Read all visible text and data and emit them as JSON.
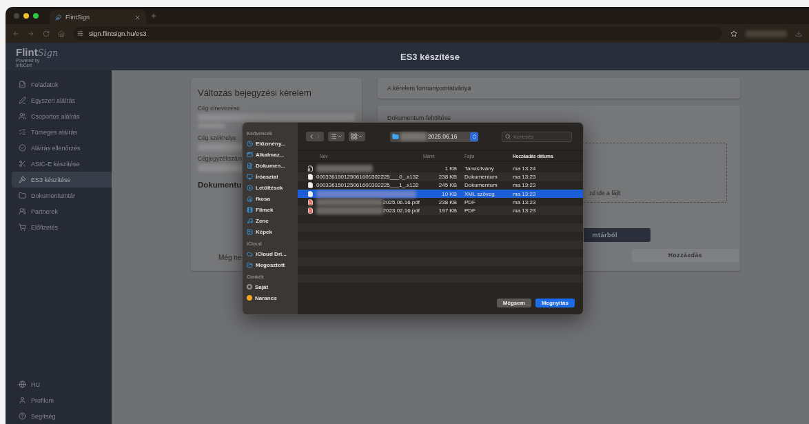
{
  "browser": {
    "tab": {
      "title": "FlintSign"
    },
    "address": "sign.flintsign.hu/es3"
  },
  "app": {
    "logo": {
      "word": "Flint",
      "script": "Sign",
      "tagline": "Powered by",
      "brand": "InfoCert"
    },
    "page_title": "ES3 készítése"
  },
  "sidebar": {
    "items": [
      {
        "label": "Feladatok",
        "selected": false
      },
      {
        "label": "Egyszeri aláírás",
        "selected": false
      },
      {
        "label": "Csoportos aláírás",
        "selected": false
      },
      {
        "label": "Tömeges aláírás",
        "selected": false
      },
      {
        "label": "Aláírás ellenőrzés",
        "selected": false
      },
      {
        "label": "ASIC-E készítése",
        "selected": false
      },
      {
        "label": "ES3 készítése",
        "selected": true
      },
      {
        "label": "Dokumentumtár",
        "selected": false
      },
      {
        "label": "Partnerek",
        "selected": false
      },
      {
        "label": "Előfizetés",
        "selected": false
      }
    ],
    "bottom": [
      {
        "label": "HU"
      },
      {
        "label": "Profilom"
      },
      {
        "label": "Segítség"
      }
    ]
  },
  "request": {
    "title": "Változás bejegyzési kérelem",
    "fields": [
      {
        "label": "Cég elnevezése"
      },
      {
        "label": "Cég székhelye"
      },
      {
        "label": "Cégjegyzékszám"
      }
    ],
    "documents_heading": "Dokumentu",
    "empty_text": "Még ne"
  },
  "form_card": {
    "title": "A kérelem formanyomtatványa"
  },
  "upload": {
    "title": "Dokumentum feltöltése",
    "drop_text": "zd ide a fájlt",
    "library_button": "mtárból",
    "add_button": {
      "label": "Hozzáadás",
      "disabled": true
    }
  },
  "dialog": {
    "sidebar": [
      {
        "title": "Kedvencek",
        "items": [
          {
            "label": "Előzmény..."
          },
          {
            "label": "Alkalmaz..."
          },
          {
            "label": "Dokumen..."
          },
          {
            "label": "Íróasztal"
          },
          {
            "label": "Letöltések"
          },
          {
            "label": "fkosa"
          },
          {
            "label": "Filmek"
          },
          {
            "label": "Zene"
          },
          {
            "label": "Képek"
          }
        ]
      },
      {
        "title": "iCloud",
        "items": [
          {
            "label": "iCloud Dri..."
          },
          {
            "label": "Megosztott"
          }
        ]
      },
      {
        "title": "Címkék",
        "items": [
          {
            "label": "Saját",
            "color": "#8e8e8e"
          },
          {
            "label": "Narancs",
            "color": "#f5a623"
          }
        ]
      }
    ],
    "path": "2025.06.16",
    "search": {
      "placeholder": "Keresés"
    },
    "columns": [
      {
        "label": "Név",
        "sorted": false
      },
      {
        "label": "Méret",
        "sorted": false
      },
      {
        "label": "Fajta",
        "sorted": false
      },
      {
        "label": "Hozzáadás dátuma",
        "sorted": true
      }
    ],
    "files": [
      {
        "kind": "cert",
        "redacted": true,
        "size": "1 KB",
        "type": "Tanúsítvány",
        "date": "ma 13:24",
        "selected": false
      },
      {
        "kind": "doc",
        "redacted": false,
        "name": "000336150125061600302225___0_.x132",
        "size": "238 KB",
        "type": "Dokumentum",
        "date": "ma 13:23",
        "selected": false
      },
      {
        "kind": "doc",
        "redacted": false,
        "name": "000336150125061600302225___1_.x132",
        "size": "245 KB",
        "type": "Dokumentum",
        "date": "ma 13:23",
        "selected": false
      },
      {
        "kind": "doc",
        "redacted": true,
        "size": "10 KB",
        "type": "XML szöveg",
        "date": "ma 13:23",
        "selected": true
      },
      {
        "kind": "pdf",
        "redacted": true,
        "name": "2025.06.16.pdf",
        "size": "238 KB",
        "type": "PDF",
        "date": "ma 13:23",
        "selected": false
      },
      {
        "kind": "pdf",
        "redacted": true,
        "name": "2023.02.16.pdf",
        "size": "197 KB",
        "type": "PDF",
        "date": "ma 13:23",
        "selected": false
      }
    ],
    "buttons": {
      "cancel": "Mégsem",
      "open": "Megnyitás"
    }
  }
}
